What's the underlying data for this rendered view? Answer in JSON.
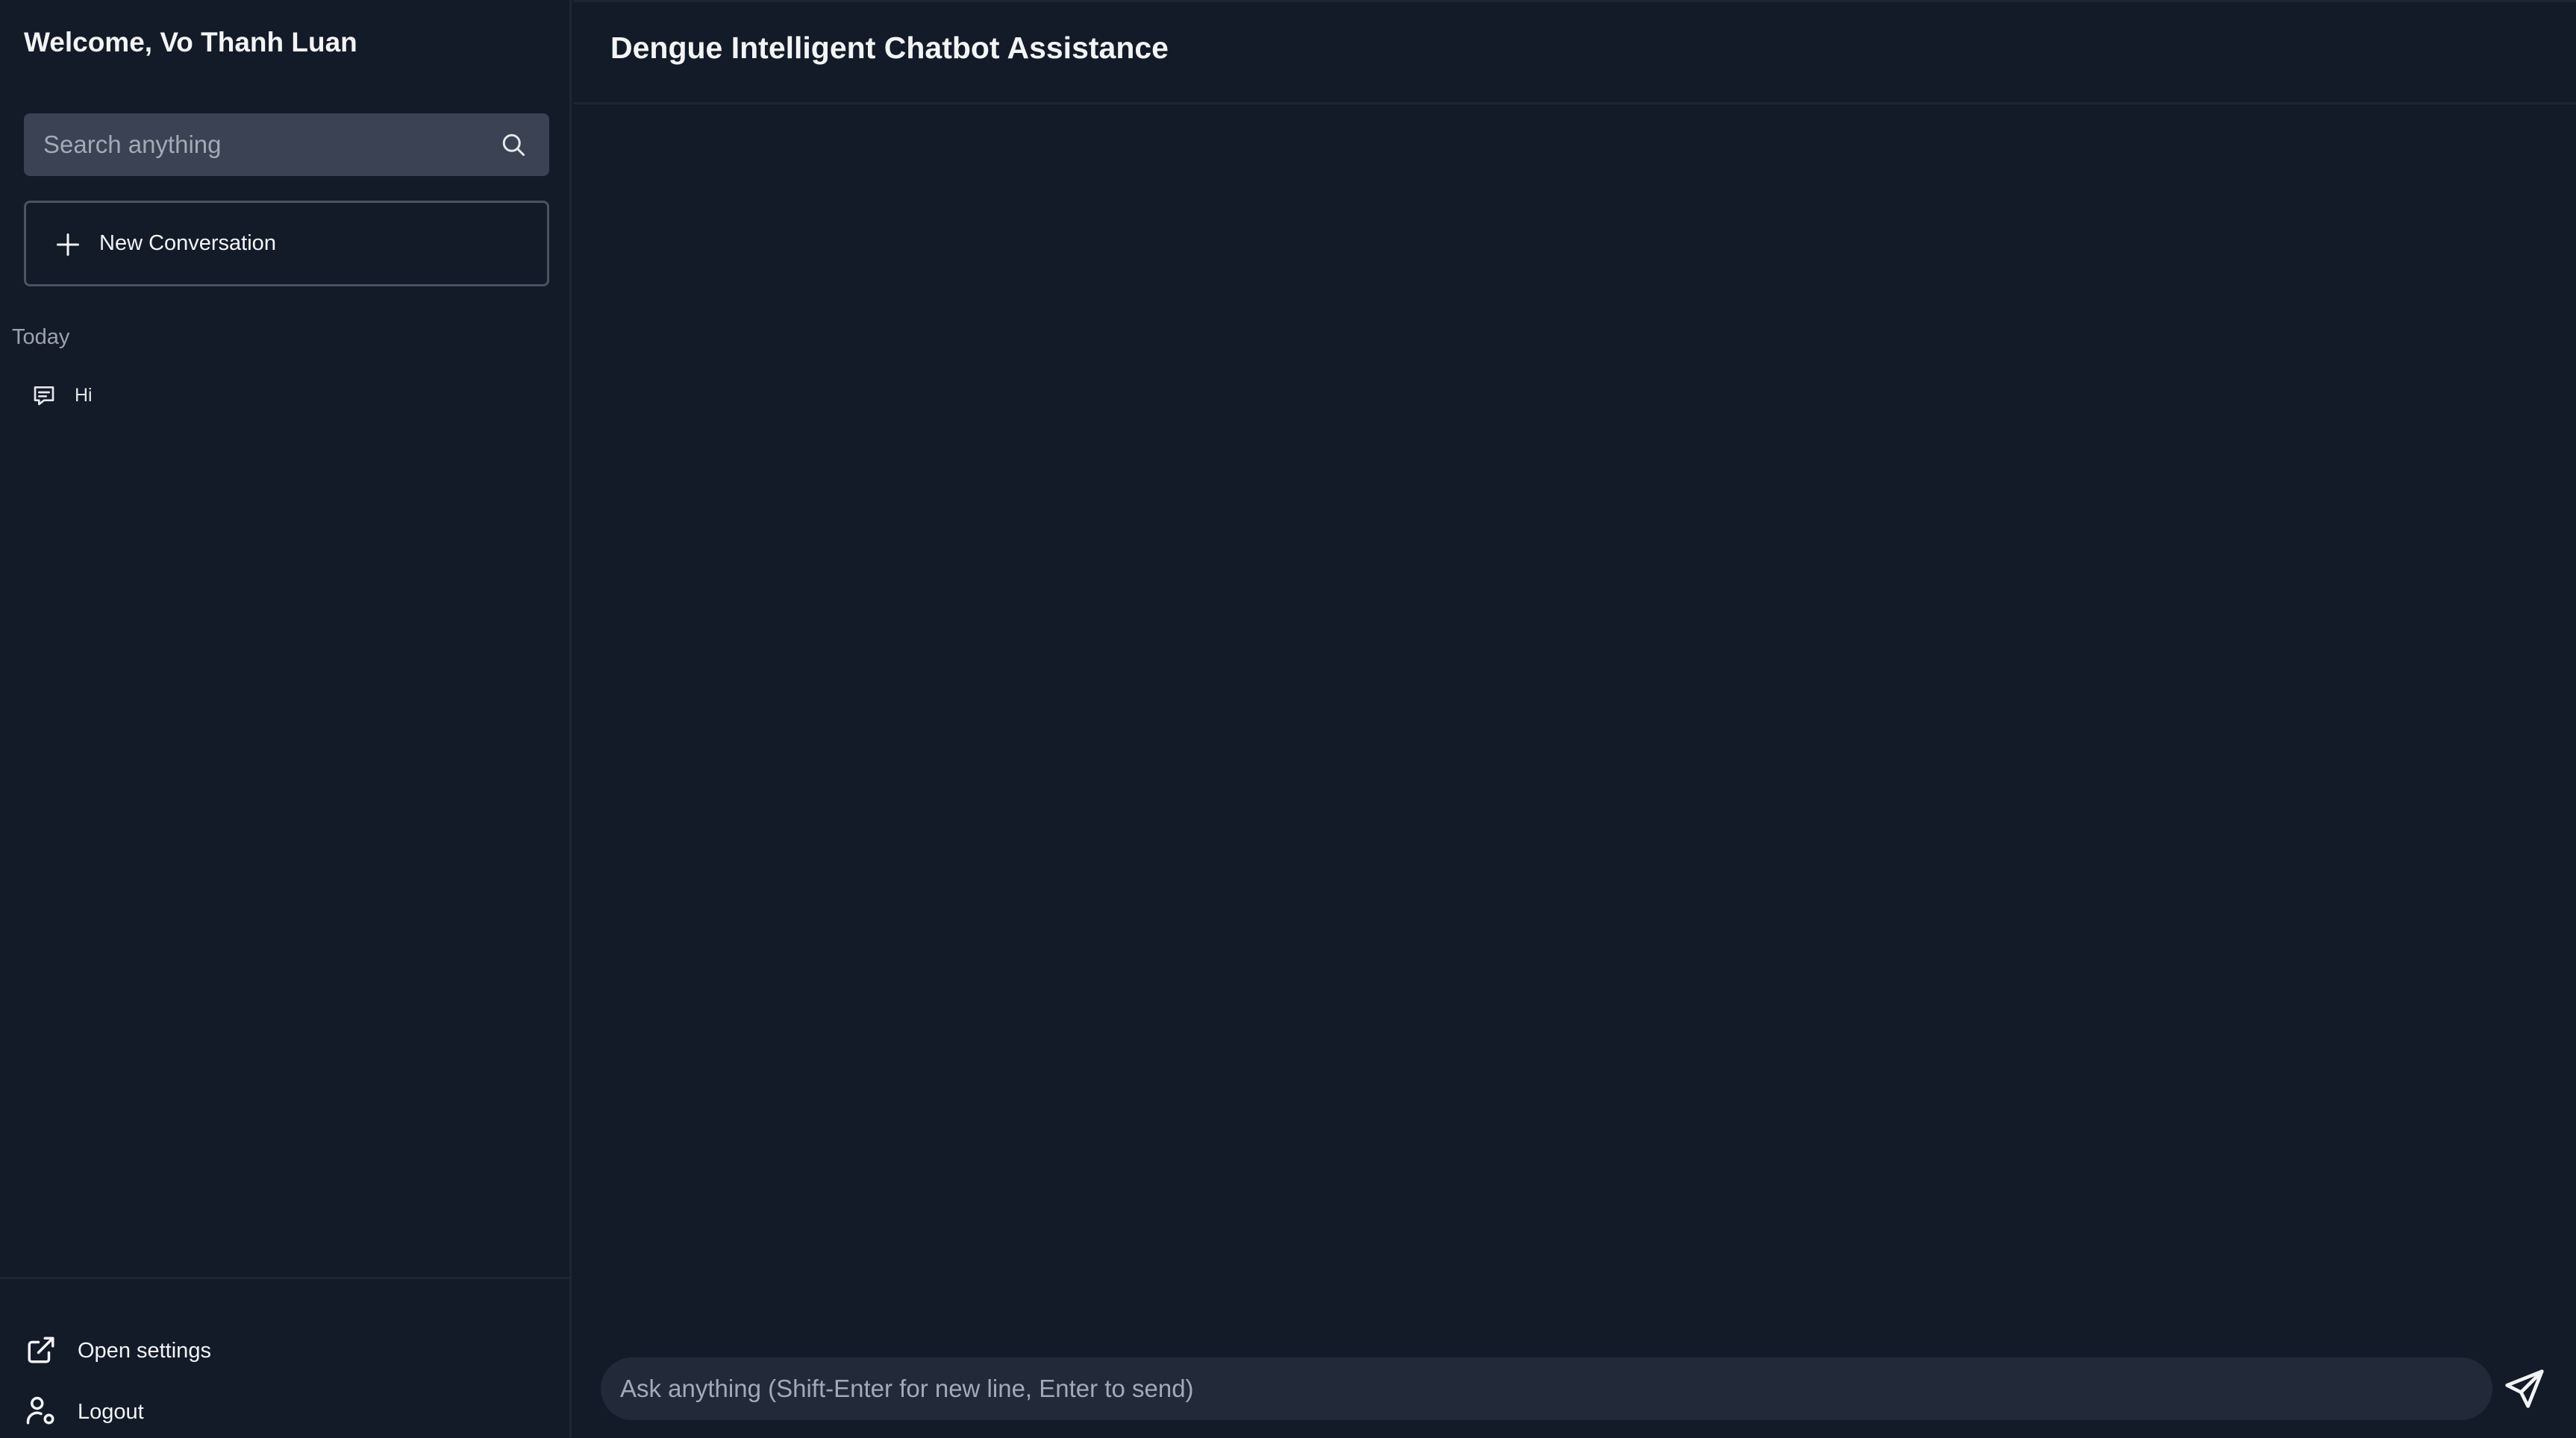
{
  "sidebar": {
    "welcome": "Welcome, Vo Thanh Luan",
    "search_placeholder": "Search anything",
    "new_conversation": "New Conversation",
    "sections": [
      {
        "label": "Today",
        "items": [
          {
            "label": "Hi",
            "icon": "chat-bubble-icon"
          }
        ]
      }
    ],
    "bottom": {
      "settings_label": "Open settings",
      "logout_label": "Logout"
    }
  },
  "main": {
    "title": "Dengue Intelligent Chatbot Assistance",
    "composer_placeholder": "Ask anything (Shift-Enter for new line, Enter to send)"
  },
  "icons": {
    "search": "search-icon",
    "plus": "plus-icon",
    "chat": "chat-bubble-icon",
    "settings": "external-link-icon",
    "logout": "user-settings-icon",
    "send": "send-icon"
  },
  "colors": {
    "background": "#131a28",
    "search_bg": "#3a4253",
    "composer_bg": "#222938",
    "border": "#4a5263",
    "text": "#f3f4f6",
    "muted_text": "#9ca3af"
  }
}
